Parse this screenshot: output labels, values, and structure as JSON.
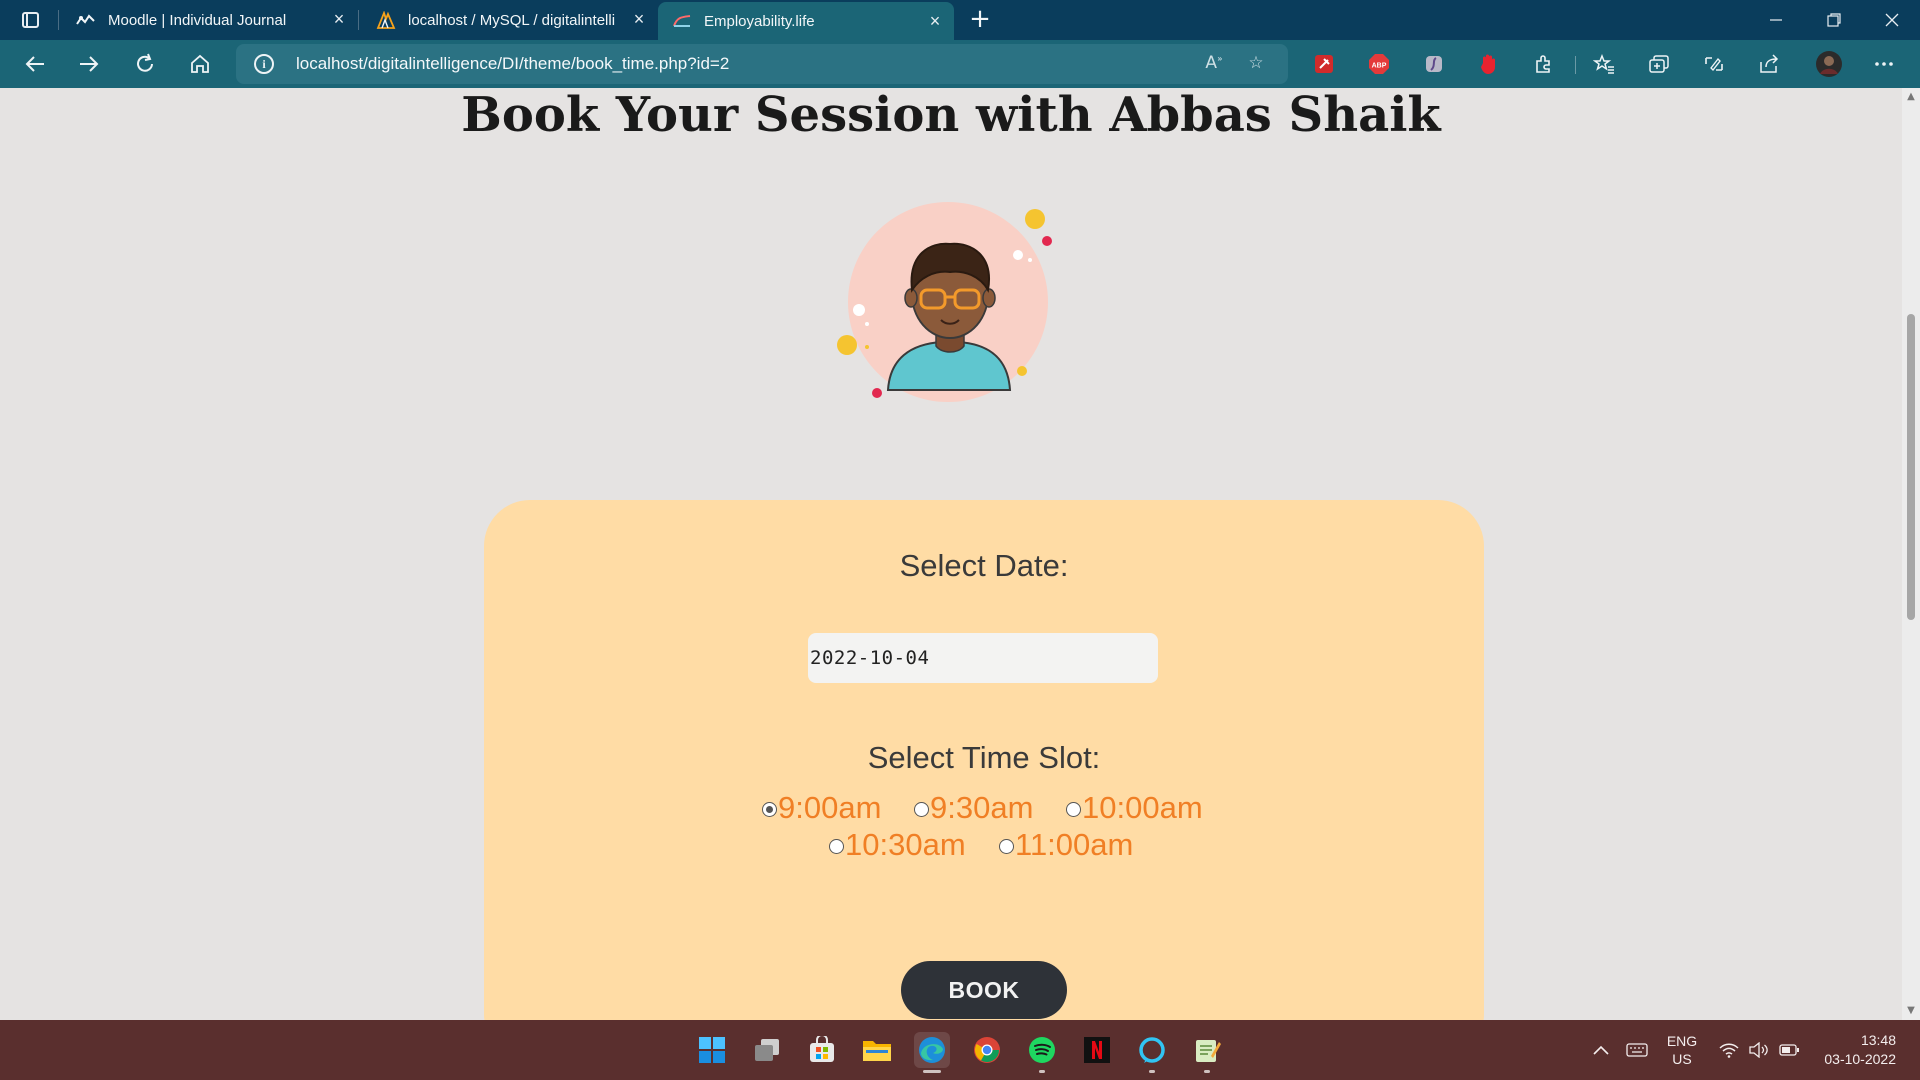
{
  "browser": {
    "tabs": [
      {
        "label": "Moodle | Individual Journal",
        "icon": "moodle-icon"
      },
      {
        "label": "localhost / MySQL / digitalintelli",
        "icon": "phpmyadmin-icon"
      },
      {
        "label": "Employability.life",
        "icon": "employability-icon",
        "active": true
      }
    ],
    "address_url": "localhost/digitalintelligence/DI/theme/book_time.php?id=2"
  },
  "page": {
    "title": "Book Your Session with Abbas Shaik",
    "form": {
      "date_label": "Select Date:",
      "date_value": "2022-10-04",
      "time_label": "Select Time Slot:",
      "slots": [
        {
          "label": "9:00am",
          "selected": true
        },
        {
          "label": "9:30am",
          "selected": false
        },
        {
          "label": "10:00am",
          "selected": false
        },
        {
          "label": "10:30am",
          "selected": false
        },
        {
          "label": "11:00am",
          "selected": false
        }
      ],
      "submit_label": "BOOK"
    }
  },
  "colors": {
    "page_bg": "#e5e3e2",
    "card_bg": "#ffdca5",
    "slot_text": "#f07f25",
    "button_bg": "#2e3238",
    "browser_toolbar": "#1b6576",
    "titlebar": "#0a3d5c",
    "taskbar": "#5a2f2e"
  },
  "taskbar": {
    "apps": [
      "windows-start-icon",
      "task-view-icon",
      "microsoft-store-icon",
      "file-explorer-icon",
      "edge-icon",
      "chrome-icon",
      "spotify-icon",
      "netflix-icon",
      "alexa-icon",
      "notepad-icon"
    ],
    "language_top": "ENG",
    "language_bottom": "US",
    "time": "13:48",
    "date": "03-10-2022"
  }
}
